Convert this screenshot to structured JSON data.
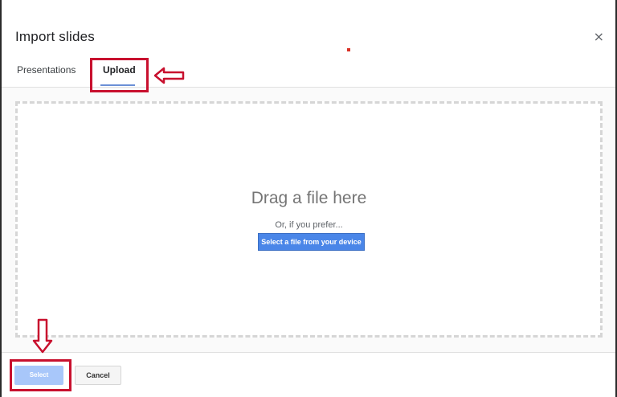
{
  "dialog": {
    "title": "Import slides",
    "close_icon": "close-icon",
    "close_glyph": "×"
  },
  "tabs": [
    {
      "label": "Presentations",
      "active": false
    },
    {
      "label": "Upload",
      "active": true
    }
  ],
  "dropzone": {
    "heading": "Drag a file here",
    "subtext": "Or, if you prefer...",
    "button_label": "Select a file from your device"
  },
  "footer": {
    "select_label": "Select",
    "select_enabled": false,
    "cancel_label": "Cancel"
  },
  "colors": {
    "accent": "#4a86e8",
    "annotation": "#c8102e",
    "select_disabled": "#a8c7fa"
  },
  "annotations": {
    "upload_arrow_icon": "arrow-left-icon",
    "select_arrow_icon": "arrow-down-icon"
  }
}
